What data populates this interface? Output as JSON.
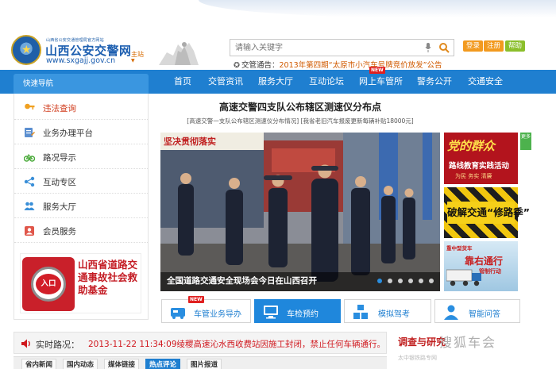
{
  "site": {
    "name": "山西公安交警网",
    "tagline": "山西省公安交通管理局官方网站",
    "url": "www.sxgajj.gov.cn",
    "site_switch": "主站"
  },
  "header": {
    "search_placeholder": "请输入关键字",
    "login": "登录",
    "register": "注册",
    "help": "帮助",
    "notice_prefix": "交管通告：",
    "notice_link": "2013年第四期“太原市小汽车号牌竞价放发”公告"
  },
  "nav": {
    "quick": "快速导航",
    "items": [
      "首页",
      "交管资讯",
      "服务大厅",
      "互动论坛",
      "网上车管所",
      "警务公开",
      "交通安全"
    ],
    "new_badge": "NEW"
  },
  "sidebar": {
    "items": [
      {
        "label": "违法查询",
        "icon": "key-icon"
      },
      {
        "label": "业务办理平台",
        "icon": "form-icon"
      },
      {
        "label": "路况导示",
        "icon": "bicycle-icon"
      },
      {
        "label": "互动专区",
        "icon": "share-icon"
      },
      {
        "label": "服务大厅",
        "icon": "people-icon"
      },
      {
        "label": "会员服务",
        "icon": "member-icon"
      }
    ],
    "fund_entry": "入口",
    "fund_title": "山西省道路交通事故社会救助基金"
  },
  "main": {
    "headline": "高速交警四支队公布辖区测速仪分布点",
    "sublink1": "[高速交警一支队公布辖区测速仪分布情况]",
    "sublink2": "[我省老旧汽车报废更新每辆补贴18000元]",
    "slide_caption": "全国道路交通安全现场会今日在山西召开",
    "slide_banner": "坚决贯彻落实",
    "slide_dots": 6,
    "slide_active": 0
  },
  "ads": {
    "ad1_big": "党的群众",
    "ad1_mid": "路线教育实践活动",
    "ad1_sm": "为民 务实 清廉",
    "tag": "更多",
    "ad2": "破解交通“修路季”",
    "ad3_top": "重中型货车",
    "ad3_mid": "靠右通行",
    "ad3_sub": "管制行动"
  },
  "services": {
    "items": [
      {
        "label": "车管业务导办",
        "icon": "car-service-icon"
      },
      {
        "label": "车检预约",
        "icon": "monitor-icon"
      },
      {
        "label": "模拟驾考",
        "icon": "blocks-icon"
      },
      {
        "label": "智能问答",
        "icon": "person-icon"
      }
    ],
    "new_badge": "NEW"
  },
  "live": {
    "label": "实时路况：",
    "text": "2013-11-22 11:34:09绫稷高速沁水西收费站因施工封闭，禁止任何车辆通行。"
  },
  "tabs": {
    "items": [
      "省内新闻",
      "国内动态",
      "媒体链接",
      "热点评论",
      "图片报道"
    ],
    "active": 3
  },
  "survey": {
    "title": "调查与研究",
    "sub": "太中银铁路专网",
    "watermark": "搜狐车会"
  },
  "colors": {
    "nav_blue": "#1f7fd0",
    "accent_orange": "#f29a1f",
    "alert_red": "#d0181e"
  }
}
